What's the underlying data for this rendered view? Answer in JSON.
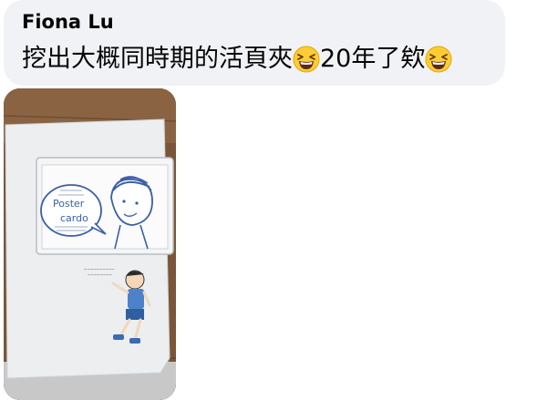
{
  "comment": {
    "author": "Fiona Lu",
    "text_part1": "挖出大概同時期的活頁夾",
    "emoji1": "grinning-squinting-face-emoji",
    "text_part2": "20年了欸",
    "emoji2": "grinning-squinting-face-emoji"
  },
  "photo": {
    "folder_title_line1": "Poster",
    "folder_title_line2": "cardo"
  },
  "colors": {
    "bubble_bg": "#f0f2f5",
    "text": "#050505",
    "folder": "#e9ecef",
    "drawing_blue": "#3a5fa8"
  }
}
